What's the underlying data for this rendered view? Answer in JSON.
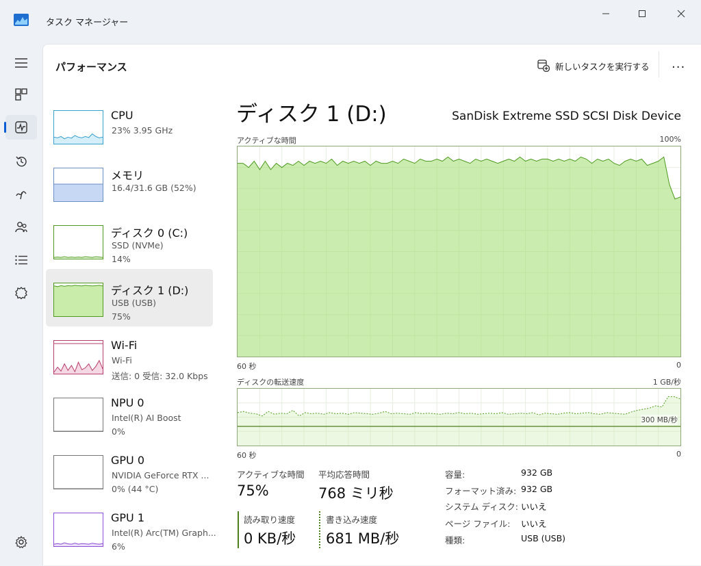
{
  "window": {
    "title": "タスク マネージャー"
  },
  "header": {
    "page_title": "パフォーマンス",
    "run_new_task": "新しいタスクを実行する",
    "more": "..."
  },
  "nav": {
    "items": [
      "hamburger-icon",
      "processes-icon",
      "performance-icon",
      "app-history-icon",
      "startup-apps-icon",
      "users-icon",
      "details-icon",
      "services-icon"
    ],
    "active": "performance-icon",
    "settings": "gear-icon"
  },
  "devices": [
    {
      "name": "CPU",
      "sub1": "23%  3.95 GHz",
      "sub2": "",
      "color": "#3aa0cf",
      "fill": "#d4eefa",
      "active": false
    },
    {
      "name": "メモリ",
      "sub1": "16.4/31.6 GB (52%)",
      "sub2": "",
      "color": "#6d8ec4",
      "fill": "#c6d8f4",
      "active": false,
      "level": 52
    },
    {
      "name": "ディスク 0 (C:)",
      "sub1": "SSD (NVMe)",
      "sub2": "14%",
      "color": "#4e9a20",
      "fill": "#e7f6d9",
      "active": false
    },
    {
      "name": "ディスク 1 (D:)",
      "sub1": "USB (USB)",
      "sub2": "75%",
      "color": "#4e9a20",
      "fill": "#c9ecaa",
      "active": true,
      "level": 75
    },
    {
      "name": "Wi-Fi",
      "sub1": "Wi-Fi",
      "sub2": "送信: 0  受信: 32.0 Kbps",
      "color": "#b63d6e",
      "fill": "#f5d8e4",
      "active": false
    },
    {
      "name": "NPU 0",
      "sub1": "Intel(R) AI Boost",
      "sub2": "0%",
      "color": "#777777",
      "fill": "#ffffff",
      "active": false
    },
    {
      "name": "GPU 0",
      "sub1": "NVIDIA GeForce RTX ...",
      "sub2": "0% (44 °C)",
      "color": "#777777",
      "fill": "#ffffff",
      "active": false
    },
    {
      "name": "GPU 1",
      "sub1": "Intel(R) Arc(TM) Graph...",
      "sub2": "6%",
      "color": "#8a4fd6",
      "fill": "#ece0fa",
      "active": false
    }
  ],
  "detail": {
    "title": "ディスク 1 (D:)",
    "model": "SanDisk Extreme SSD SCSI Disk Device",
    "graph1": {
      "label": "アクティブな時間",
      "max": "100%",
      "left": "60 秒",
      "right": "0",
      "values": [
        92,
        92,
        90,
        93,
        89,
        93,
        89,
        92,
        90,
        92,
        91,
        93,
        91,
        93,
        92,
        93,
        92,
        94,
        91,
        93,
        92,
        93,
        92,
        93,
        91,
        93,
        92,
        92,
        93,
        92,
        94,
        93,
        92,
        94,
        93,
        93,
        94,
        93,
        95,
        93,
        94,
        93,
        92,
        94,
        93,
        94,
        93,
        92,
        93,
        94,
        93,
        95,
        93,
        94,
        93,
        94,
        94,
        93,
        94,
        93,
        94,
        93,
        95,
        94,
        92,
        94,
        93,
        94,
        92,
        91,
        93,
        94,
        93,
        94,
        91,
        92,
        93,
        95,
        82,
        75,
        76
      ]
    },
    "graph2": {
      "label": "ディスクの転送速度",
      "max": "1 GB/秒",
      "mark": "300 MB/秒",
      "left": "60 秒",
      "right": "0",
      "write": [
        58,
        60,
        57,
        56,
        52,
        60,
        55,
        57,
        56,
        62,
        52,
        58,
        56,
        57,
        55,
        58,
        56,
        57,
        55,
        58,
        57,
        56,
        55,
        57,
        60,
        56,
        57,
        56,
        55,
        58,
        56,
        57,
        56,
        55,
        57,
        56,
        58,
        56,
        57,
        55,
        56,
        57,
        56,
        58,
        55,
        56,
        57,
        56,
        58,
        54,
        57,
        56,
        55,
        57,
        58,
        56,
        57,
        58,
        56,
        55,
        58,
        57,
        56,
        55,
        59,
        62,
        64,
        66,
        70,
        68,
        86,
        86,
        82
      ]
    },
    "stats": {
      "active_label": "アクティブな時間",
      "active_value": "75%",
      "resp_label": "平均応答時間",
      "resp_value": "768 ミリ秒",
      "read_label": "読み取り速度",
      "read_value": "0 KB/秒",
      "write_label": "書き込み速度",
      "write_value": "681 MB/秒"
    },
    "props": [
      {
        "k": "容量:",
        "v": "932 GB"
      },
      {
        "k": "フォーマット済み:",
        "v": "932 GB"
      },
      {
        "k": "システム ディスク:",
        "v": "いいえ"
      },
      {
        "k": "ページ ファイル:",
        "v": "いいえ"
      },
      {
        "k": "種類:",
        "v": "USB (USB)"
      }
    ]
  }
}
